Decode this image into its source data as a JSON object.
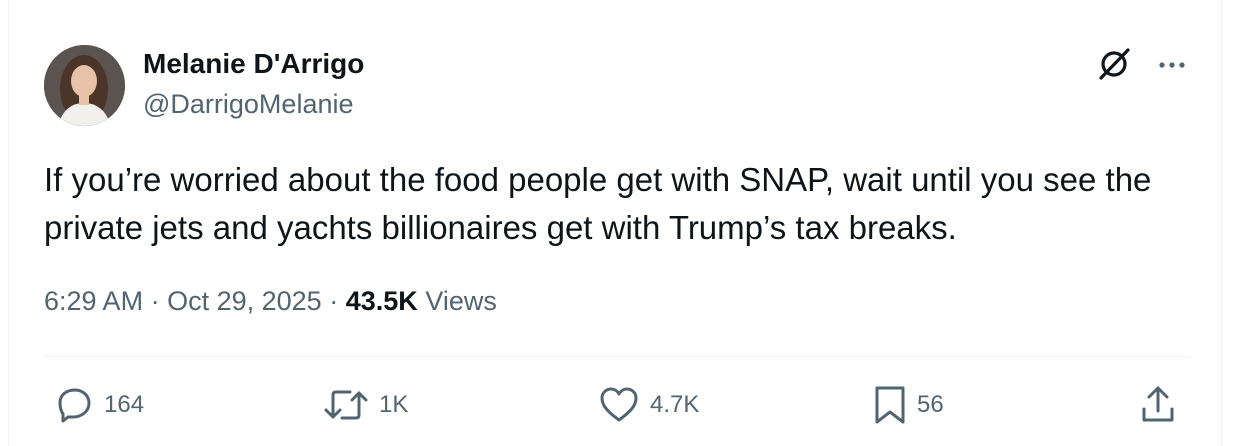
{
  "author": {
    "name": "Melanie D'Arrigo",
    "handle": "@DarrigoMelanie"
  },
  "tweet": {
    "text": "If you’re worried about the food people get with SNAP, wait until you see the private jets and yachts billionaires get with Trump’s tax breaks.",
    "time": "6:29 AM",
    "date": "Oct 29, 2025",
    "separator": "·",
    "views_count": "43.5K",
    "views_label": "Views"
  },
  "actions": {
    "replies": "164",
    "reposts": "1K",
    "likes": "4.7K",
    "bookmarks": "56"
  },
  "icons": [
    "grok-icon",
    "more-icon",
    "reply-icon",
    "repost-icon",
    "like-icon",
    "bookmark-icon",
    "share-icon"
  ],
  "colors": {
    "primary_text": "#0f1419",
    "secondary_text": "#536471",
    "divider": "#eff3f4"
  }
}
